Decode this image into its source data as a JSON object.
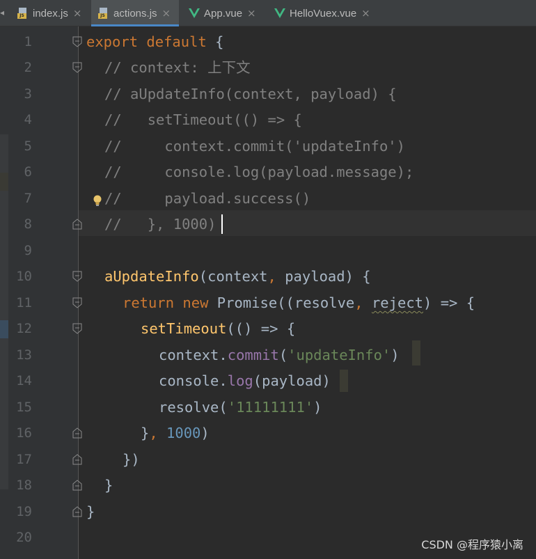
{
  "tabs": [
    {
      "label": "index.js",
      "icon": "js-file-icon",
      "active": false
    },
    {
      "label": "actions.js",
      "icon": "js-file-icon",
      "active": true
    },
    {
      "label": "App.vue",
      "icon": "vue-file-icon",
      "active": false
    },
    {
      "label": "HelloVuex.vue",
      "icon": "vue-file-icon",
      "active": false
    }
  ],
  "tab_close_glyph": "×",
  "line_numbers": [
    "1",
    "2",
    "3",
    "4",
    "5",
    "6",
    "7",
    "8",
    "9",
    "10",
    "11",
    "12",
    "13",
    "14",
    "15",
    "16",
    "17",
    "18",
    "19",
    "20"
  ],
  "code": {
    "l1": {
      "kw1": "export",
      "kw2": "default",
      "rest": " {"
    },
    "l2": "// context: 上下文",
    "l3": "// aUpdateInfo(context, payload) {",
    "l4": "//   setTimeout(() => {",
    "l5": "//     context.commit('updateInfo')",
    "l6": "//     console.log(payload.message);",
    "l7": "//     payload.success()",
    "l8": "//   }, 1000)",
    "l10": {
      "name": "aUpdateInfo",
      "open": "(context",
      "comma": ",",
      "rest": " payload) {"
    },
    "l11": {
      "kw_return": "return",
      "kw_new": "new",
      "cls": " Promise((resolve",
      "comma": ",",
      "param": "reject",
      "rest": ") => {"
    },
    "l12": {
      "fn": "setTimeout",
      "rest": "(() => {"
    },
    "l13": {
      "obj": "context.",
      "method": "commit",
      "open": "(",
      "str": "'updateInfo'",
      "close": ")"
    },
    "l14": {
      "obj": "console.",
      "method": "log",
      "rest": "(payload)"
    },
    "l15": {
      "pre": "resolve(",
      "str": "'11111111'",
      "close": ")"
    },
    "l16": {
      "brace": "}",
      "comma": ",",
      "num": " 1000",
      "close": ")"
    },
    "l17": "})",
    "l18": "}",
    "l19": "}"
  },
  "colors": {
    "background": "#2b2b2b",
    "keyword": "#cc7832",
    "comment": "#808080",
    "function": "#ffc66d",
    "string": "#6a8759",
    "number": "#6897bb",
    "member": "#9876aa",
    "accent": "#4a88c7"
  },
  "watermark": "CSDN @程序猿小离"
}
